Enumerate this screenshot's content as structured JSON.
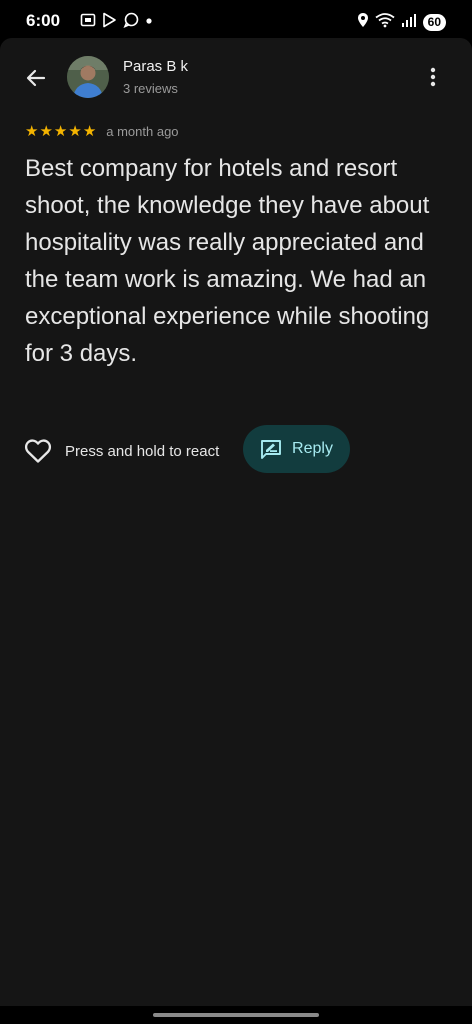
{
  "status_bar": {
    "time": "6:00",
    "battery": "60",
    "left_icons": [
      "screenshot-icon",
      "play-store-icon",
      "whatsapp-icon",
      "notification-dot-icon"
    ],
    "right_icons": [
      "location-icon",
      "wifi-icon",
      "signal-icon"
    ]
  },
  "review": {
    "reviewer_name": "Paras B k",
    "reviewer_count": "3 reviews",
    "rating": 5,
    "max_rating": 5,
    "time_ago": "a month ago",
    "text": "Best company for hotels and resort shoot, the knowledge they have about hospitality was really appreciated and the team work is amazing. We had an exceptional experience while shooting for 3 days."
  },
  "actions": {
    "react_label": "Press and hold to react",
    "reply_label": "Reply"
  },
  "colors": {
    "background": "#151515",
    "star": "#f4b400",
    "reply_bg": "#123c3e",
    "reply_text": "#a6eaf0"
  },
  "icons": {
    "back": "arrow-back-icon",
    "more": "more-vert-icon",
    "react": "heart-outline-icon",
    "reply": "rate-review-icon"
  }
}
